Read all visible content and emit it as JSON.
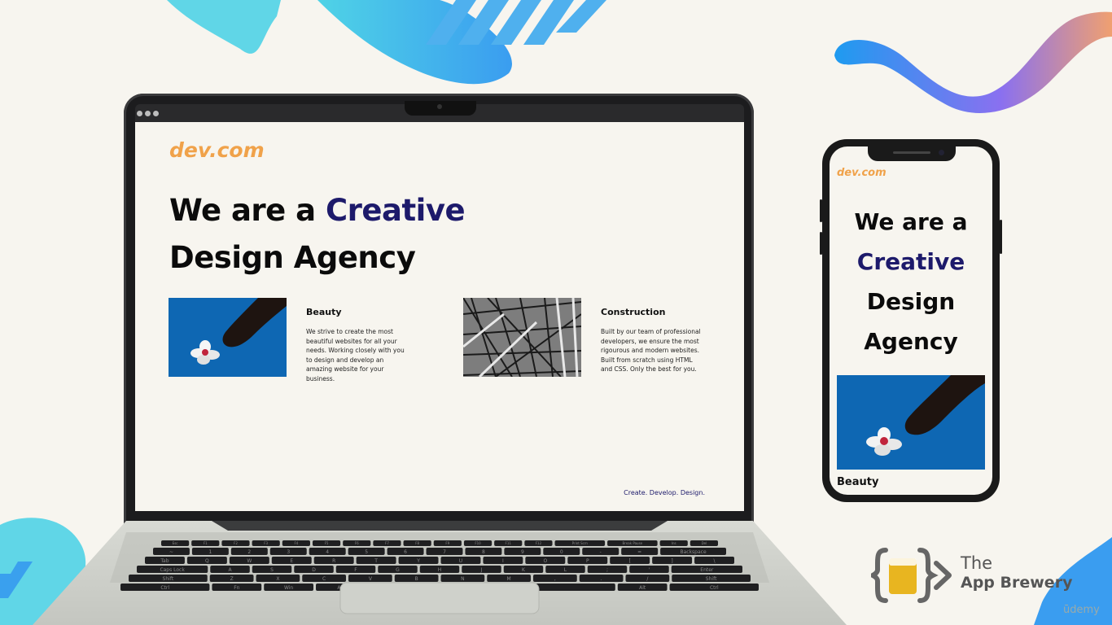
{
  "desktop_site": {
    "logo": "dev.com",
    "hero_line1_plain": "We are a ",
    "hero_line1_accent": "Creative",
    "hero_line2": "Design Agency",
    "cards": [
      {
        "title": "Beauty",
        "text": "We strive to create the most beautiful websites for all your needs. Working closely with you to design and develop an amazing website for your business.",
        "image": "flower-in-water"
      },
      {
        "title": "Construction",
        "text": "Built by our team of professional developers, we ensure the most rigourous and modern websites. Built from scratch using HTML and CSS. Only the best for you.",
        "image": "steel-structure"
      }
    ],
    "tagline": "Create. Develop. Design."
  },
  "mobile_site": {
    "logo": "dev.com",
    "hero_l1": "We are a",
    "hero_l2": "Creative",
    "hero_l3": "Design",
    "hero_l4": "Agency",
    "card_title": "Beauty",
    "image": "flower-in-water"
  },
  "keyboard": {
    "fn_row": [
      "Esc",
      "F1",
      "F2",
      "F3",
      "F4",
      "F5",
      "F6",
      "F7",
      "F8",
      "F9",
      "F10",
      "F11",
      "F12",
      "Print Scrn",
      "Break Pause",
      "Ins",
      "Del"
    ],
    "num_row": [
      "~",
      "1",
      "2",
      "3",
      "4",
      "5",
      "6",
      "7",
      "8",
      "9",
      "0",
      "-",
      "=",
      "Backspace"
    ],
    "top_row": [
      "Tab",
      "Q",
      "W",
      "E",
      "R",
      "T",
      "Y",
      "U",
      "I",
      "O",
      "P",
      "[",
      "]",
      "\\"
    ],
    "home_row": [
      "Caps Lock",
      "A",
      "S",
      "D",
      "F",
      "G",
      "H",
      "J",
      "K",
      "L",
      ";",
      "'",
      "Enter"
    ],
    "bottom_row": [
      "Shift",
      "Z",
      "X",
      "C",
      "V",
      "B",
      "N",
      "M",
      ",",
      ".",
      "/",
      "Shift"
    ],
    "space_row": [
      "Ctrl",
      "Fn",
      "Win",
      "Alt",
      "",
      "Alt",
      "Ctrl"
    ]
  },
  "branding": {
    "the": "The",
    "name": "App Brewery",
    "watermark": "ūdemy"
  },
  "colors": {
    "background": "#f7f5ef",
    "logo_orange": "#f0a24a",
    "accent_navy": "#1d1a6b",
    "deco_cyan": "#4fd3e6",
    "deco_blue": "#3a8df0",
    "deco_purple": "#b070f0"
  }
}
